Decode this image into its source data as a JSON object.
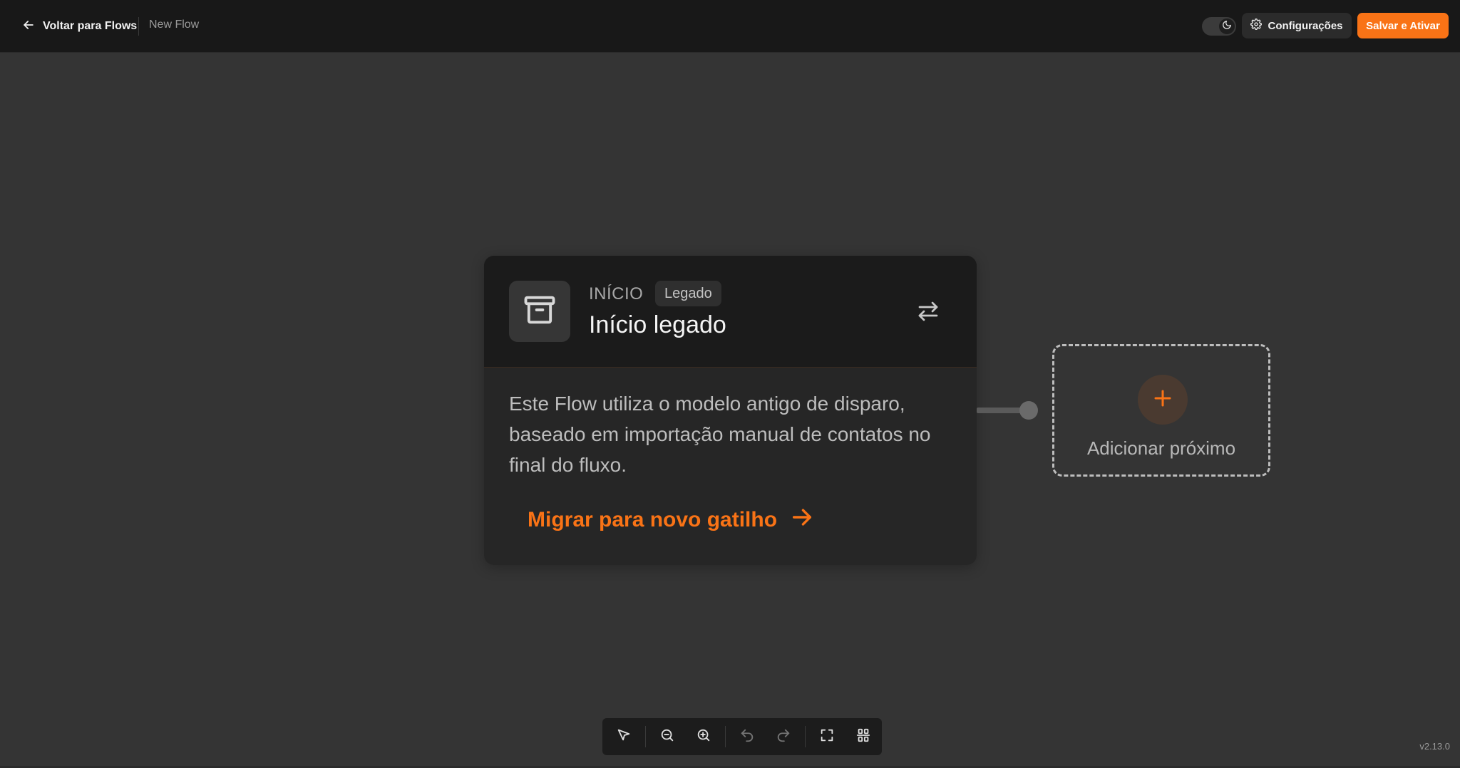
{
  "header": {
    "back_label": "Voltar para Flows",
    "flow_name": "New Flow",
    "settings_label": "Configurações",
    "save_label": "Salvar e Ativar"
  },
  "node": {
    "kicker": "INÍCIO",
    "badge": "Legado",
    "title": "Início legado",
    "description": "Este Flow utiliza o modelo antigo de disparo, baseado em importação manual de contatos no final do fluxo.",
    "migrate_label": "Migrar para novo gatilho"
  },
  "add_next": {
    "label": "Adicionar próximo"
  },
  "toolbar": {
    "tools": [
      "select-icon",
      "zoom-out-icon",
      "zoom-in-icon",
      "undo-icon",
      "redo-icon",
      "fit-view-icon",
      "auto-layout-icon"
    ]
  },
  "footer": {
    "version": "v2.13.0"
  },
  "colors": {
    "accent": "#f97316",
    "canvas": "#343434",
    "header": "#181818"
  }
}
